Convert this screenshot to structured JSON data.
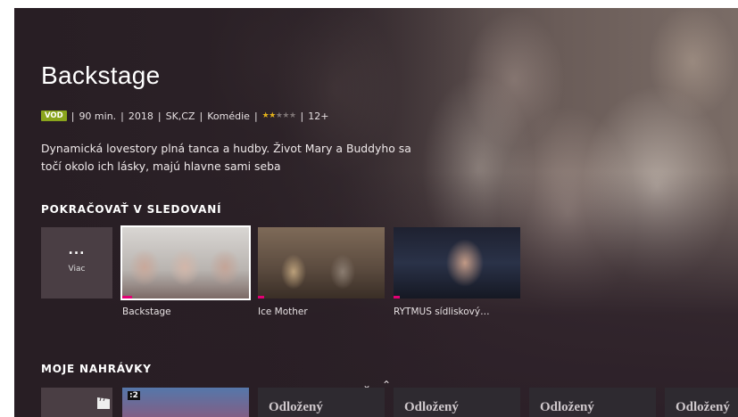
{
  "hero": {
    "title": "Backstage",
    "badge": "VOD",
    "duration": "90 min.",
    "year": "2018",
    "country": "SK,CZ",
    "genre": "Komédie",
    "rating_stars": 2,
    "rating_max": 5,
    "age": "12+",
    "separator": "|",
    "description": "Dynamická lovestory plná tanca a hudby. Život Mary a Buddyho sa točí okolo ich lásky, majú hlavne sami seba"
  },
  "continue_watching": {
    "heading": "POKRAČOVAŤ V SLEDOVANÍ",
    "more_icon": "...",
    "more_label": "Viac",
    "items": [
      {
        "title": "Backstage",
        "progress": 0.08
      },
      {
        "title": "Ice Mother",
        "progress": 0.05
      },
      {
        "title": "RYTMUS sídliskový…",
        "progress": 0.05
      }
    ]
  },
  "recordings": {
    "heading": "MOJE NAHRÁVKY",
    "channel_badge": ":2",
    "items": [
      {
        "title": ""
      },
      {
        "title": "Odložený"
      },
      {
        "title": "Odložený"
      },
      {
        "title": "Odložený"
      },
      {
        "title": "Odložený"
      }
    ]
  },
  "colors": {
    "accent": "#e20074",
    "vod_badge": "#8aa51c",
    "star": "#e3b21a"
  },
  "icons": {
    "scroll_down": "chevron-down-icon",
    "scroll_up": "chevron-up-icon",
    "recordings": "clapperboard-icon"
  }
}
